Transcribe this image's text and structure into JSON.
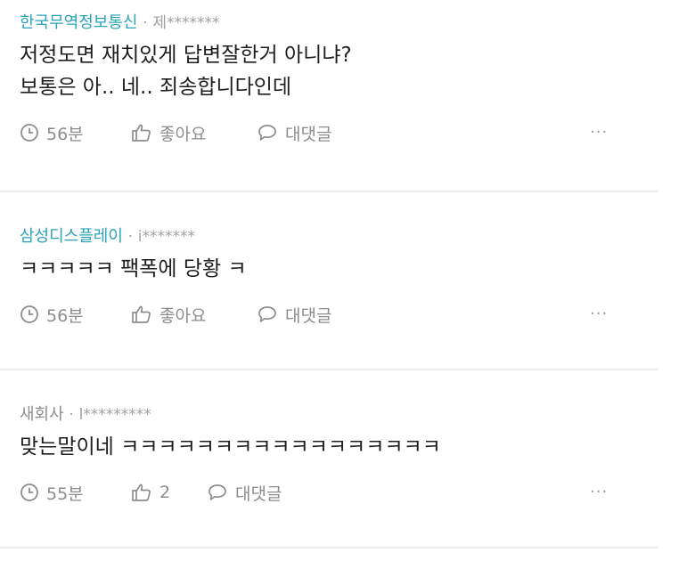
{
  "comments": [
    {
      "company": "한국무역정보통신",
      "separator": "·",
      "user": "제*******",
      "lines": [
        "저정도면 재치있게 답변잘한거 아니냐?",
        "보통은 아.. 네.. 죄송합니다인데"
      ],
      "time": "56분",
      "like_label": "좋아요",
      "reply_label": "대댓글",
      "more": "···"
    },
    {
      "company": "삼성디스플레이",
      "separator": "·",
      "user": "i*******",
      "lines": [
        "ㅋㅋㅋㅋㅋ 팩폭에 당황 ㅋ"
      ],
      "time": "56분",
      "like_label": "좋아요",
      "reply_label": "대댓글",
      "more": "···"
    },
    {
      "company": "새회사",
      "separator": "·",
      "user": "l*********",
      "lines": [
        "맞는말이네 ㅋㅋㅋㅋㅋㅋㅋㅋㅋㅋㅋㅋㅋㅋㅋㅋㅋ"
      ],
      "time": "55분",
      "like_label": "2",
      "reply_label": "대댓글",
      "more": "···"
    }
  ],
  "colors": {
    "company_highlight": "#2aa3b8",
    "company_plain": "#8e8e8e",
    "meta_gray": "#8d8d8d",
    "divider": "#ececec"
  },
  "icons": {
    "time": "clock-icon",
    "like": "thumbs-up-icon",
    "reply": "speech-bubble-icon",
    "more": "more-options-icon"
  }
}
